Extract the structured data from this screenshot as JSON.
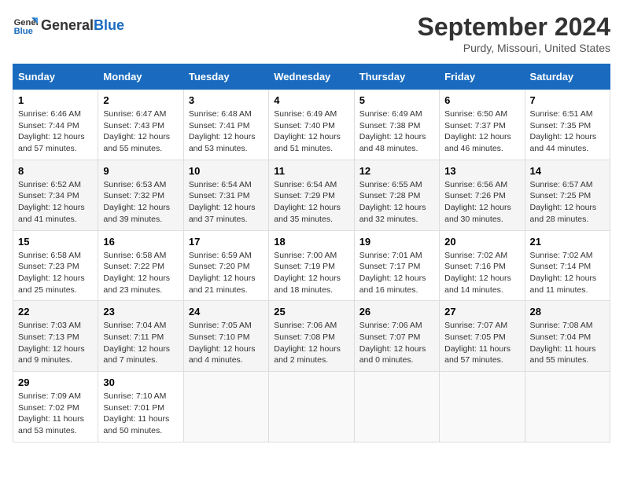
{
  "logo": {
    "general": "General",
    "blue": "Blue"
  },
  "title": "September 2024",
  "subtitle": "Purdy, Missouri, United States",
  "days_of_week": [
    "Sunday",
    "Monday",
    "Tuesday",
    "Wednesday",
    "Thursday",
    "Friday",
    "Saturday"
  ],
  "weeks": [
    [
      {
        "day": 1,
        "info": "Sunrise: 6:46 AM\nSunset: 7:44 PM\nDaylight: 12 hours and 57 minutes."
      },
      {
        "day": 2,
        "info": "Sunrise: 6:47 AM\nSunset: 7:43 PM\nDaylight: 12 hours and 55 minutes."
      },
      {
        "day": 3,
        "info": "Sunrise: 6:48 AM\nSunset: 7:41 PM\nDaylight: 12 hours and 53 minutes."
      },
      {
        "day": 4,
        "info": "Sunrise: 6:49 AM\nSunset: 7:40 PM\nDaylight: 12 hours and 51 minutes."
      },
      {
        "day": 5,
        "info": "Sunrise: 6:49 AM\nSunset: 7:38 PM\nDaylight: 12 hours and 48 minutes."
      },
      {
        "day": 6,
        "info": "Sunrise: 6:50 AM\nSunset: 7:37 PM\nDaylight: 12 hours and 46 minutes."
      },
      {
        "day": 7,
        "info": "Sunrise: 6:51 AM\nSunset: 7:35 PM\nDaylight: 12 hours and 44 minutes."
      }
    ],
    [
      {
        "day": 8,
        "info": "Sunrise: 6:52 AM\nSunset: 7:34 PM\nDaylight: 12 hours and 41 minutes."
      },
      {
        "day": 9,
        "info": "Sunrise: 6:53 AM\nSunset: 7:32 PM\nDaylight: 12 hours and 39 minutes."
      },
      {
        "day": 10,
        "info": "Sunrise: 6:54 AM\nSunset: 7:31 PM\nDaylight: 12 hours and 37 minutes."
      },
      {
        "day": 11,
        "info": "Sunrise: 6:54 AM\nSunset: 7:29 PM\nDaylight: 12 hours and 35 minutes."
      },
      {
        "day": 12,
        "info": "Sunrise: 6:55 AM\nSunset: 7:28 PM\nDaylight: 12 hours and 32 minutes."
      },
      {
        "day": 13,
        "info": "Sunrise: 6:56 AM\nSunset: 7:26 PM\nDaylight: 12 hours and 30 minutes."
      },
      {
        "day": 14,
        "info": "Sunrise: 6:57 AM\nSunset: 7:25 PM\nDaylight: 12 hours and 28 minutes."
      }
    ],
    [
      {
        "day": 15,
        "info": "Sunrise: 6:58 AM\nSunset: 7:23 PM\nDaylight: 12 hours and 25 minutes."
      },
      {
        "day": 16,
        "info": "Sunrise: 6:58 AM\nSunset: 7:22 PM\nDaylight: 12 hours and 23 minutes."
      },
      {
        "day": 17,
        "info": "Sunrise: 6:59 AM\nSunset: 7:20 PM\nDaylight: 12 hours and 21 minutes."
      },
      {
        "day": 18,
        "info": "Sunrise: 7:00 AM\nSunset: 7:19 PM\nDaylight: 12 hours and 18 minutes."
      },
      {
        "day": 19,
        "info": "Sunrise: 7:01 AM\nSunset: 7:17 PM\nDaylight: 12 hours and 16 minutes."
      },
      {
        "day": 20,
        "info": "Sunrise: 7:02 AM\nSunset: 7:16 PM\nDaylight: 12 hours and 14 minutes."
      },
      {
        "day": 21,
        "info": "Sunrise: 7:02 AM\nSunset: 7:14 PM\nDaylight: 12 hours and 11 minutes."
      }
    ],
    [
      {
        "day": 22,
        "info": "Sunrise: 7:03 AM\nSunset: 7:13 PM\nDaylight: 12 hours and 9 minutes."
      },
      {
        "day": 23,
        "info": "Sunrise: 7:04 AM\nSunset: 7:11 PM\nDaylight: 12 hours and 7 minutes."
      },
      {
        "day": 24,
        "info": "Sunrise: 7:05 AM\nSunset: 7:10 PM\nDaylight: 12 hours and 4 minutes."
      },
      {
        "day": 25,
        "info": "Sunrise: 7:06 AM\nSunset: 7:08 PM\nDaylight: 12 hours and 2 minutes."
      },
      {
        "day": 26,
        "info": "Sunrise: 7:06 AM\nSunset: 7:07 PM\nDaylight: 12 hours and 0 minutes."
      },
      {
        "day": 27,
        "info": "Sunrise: 7:07 AM\nSunset: 7:05 PM\nDaylight: 11 hours and 57 minutes."
      },
      {
        "day": 28,
        "info": "Sunrise: 7:08 AM\nSunset: 7:04 PM\nDaylight: 11 hours and 55 minutes."
      }
    ],
    [
      {
        "day": 29,
        "info": "Sunrise: 7:09 AM\nSunset: 7:02 PM\nDaylight: 11 hours and 53 minutes."
      },
      {
        "day": 30,
        "info": "Sunrise: 7:10 AM\nSunset: 7:01 PM\nDaylight: 11 hours and 50 minutes."
      },
      null,
      null,
      null,
      null,
      null
    ]
  ]
}
